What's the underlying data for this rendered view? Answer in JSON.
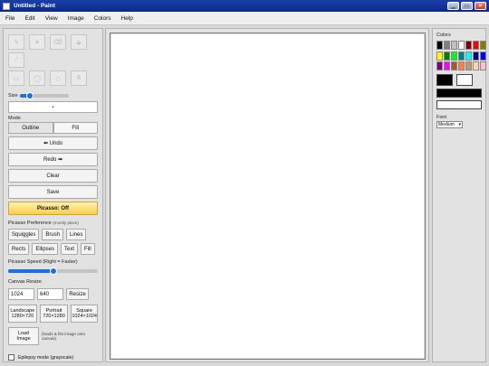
{
  "window": {
    "title": "Untitled - Paint",
    "controls": [
      "minimize",
      "maximize",
      "close"
    ]
  },
  "menu": [
    "File",
    "Edit",
    "View",
    "Image",
    "Colors",
    "Help"
  ],
  "tools": [
    "pencil-icon",
    "star-icon",
    "eraser-icon",
    "bucket-icon",
    "line-icon",
    "rectangle-icon",
    "ellipse-icon",
    "text-icon"
  ],
  "tools_glyphs": [
    "✎",
    "✶",
    "⌫",
    "⬙",
    "⁄",
    "▭",
    "◯",
    "A"
  ],
  "size": {
    "label": "Size",
    "value": 0.2,
    "preview": "•"
  },
  "mode": {
    "label": "Mode",
    "options": [
      "Outline",
      "Fill"
    ],
    "selected": "Outline"
  },
  "actions": {
    "undo": "⬅ Undo",
    "redo": "Redo ➡",
    "clear": "Clear",
    "save": "Save",
    "picasso": "Picasso: Off"
  },
  "picasso_pref": {
    "label": "Picasso Preference",
    "hint": "(mostly place)",
    "row1": [
      "Squiggles",
      "Brush",
      "Lines"
    ],
    "row2": [
      "Rects",
      "Ellipses",
      "Text",
      "Fill"
    ]
  },
  "speed": {
    "label": "Picasso Speed (Right = Faster)",
    "value": 0.5
  },
  "canvas_resize": {
    "label": "Canvas Resize",
    "width": "1024",
    "height": "640",
    "button": "Resize"
  },
  "presets": [
    {
      "name": "Landscape",
      "dims": "1280×720"
    },
    {
      "name": "Portrait",
      "dims": "720×1280"
    },
    {
      "name": "Square",
      "dims": "1024×1024"
    }
  ],
  "load": {
    "line1": "Load",
    "line2": "Image",
    "note": "(loads & fits image onto canvas)"
  },
  "epilepsy": {
    "label": "Epilepsy mode (grayscale)",
    "checked": false
  },
  "colors": {
    "label": "Colors",
    "palette": [
      "#000000",
      "#808080",
      "#c0c0c0",
      "#ffffff",
      "#800000",
      "#ff0000",
      "#808000",
      "#ffff00",
      "#008000",
      "#00ff00",
      "#008080",
      "#00ffff",
      "#000080",
      "#0000ff",
      "#800080",
      "#ff00ff",
      "#a05a2c",
      "#ff8040",
      "#c89664",
      "#ffd8b0",
      "#ffc0cb"
    ],
    "primary": "#000000",
    "secondary": "#ffffff"
  },
  "font": {
    "label": "Font",
    "value": "Medium"
  }
}
